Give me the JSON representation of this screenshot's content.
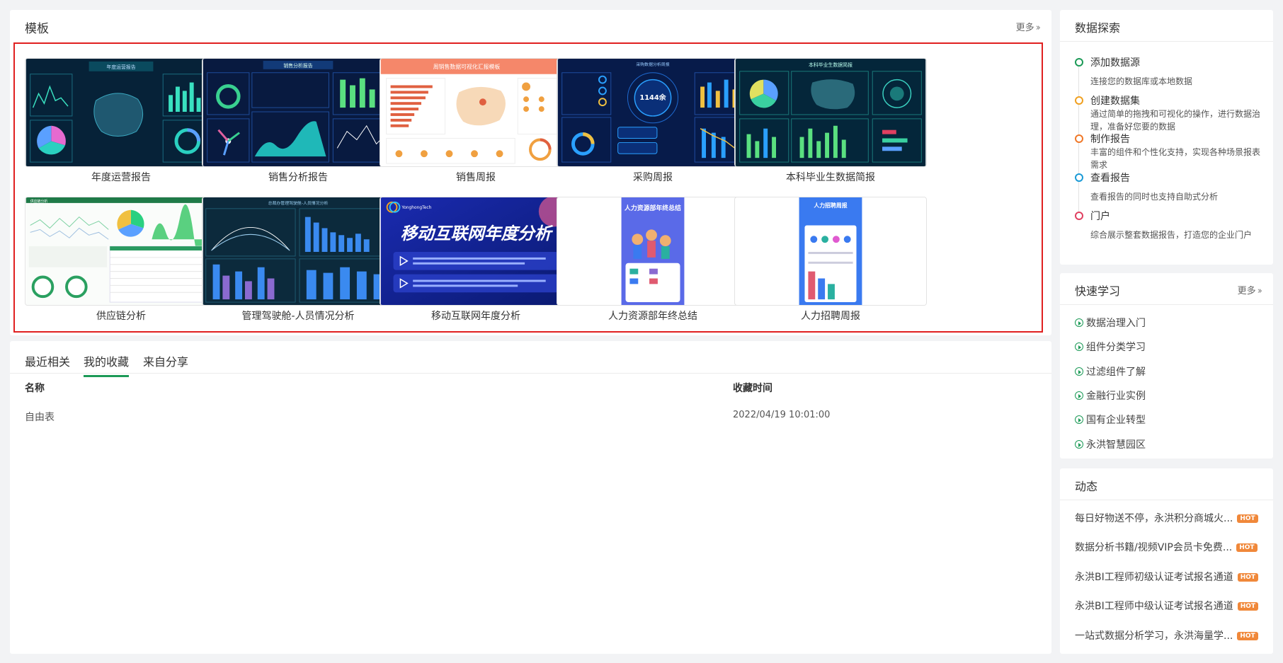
{
  "templates": {
    "title": "模板",
    "more": "更多",
    "cards": [
      {
        "label": "年度运营报告",
        "image_title": "年度运营报告"
      },
      {
        "label": "销售分析报告",
        "image_title": "销售分析报告"
      },
      {
        "label": "销售周报",
        "image_title": "周销售数据可视化汇报模板"
      },
      {
        "label": "采购周报",
        "image_title": "采购数据分析周报",
        "image_value": "1144余"
      },
      {
        "label": "本科毕业生数据简报",
        "image_title": "本科毕业生数据简报"
      },
      {
        "label": "供应链分析",
        "image_title": "供应链分析"
      },
      {
        "label": "管理驾驶舱-人员情况分析",
        "image_title": "总裁办管理驾驶舱-人员情况分析"
      },
      {
        "label": "移动互联网年度分析",
        "image_title": "移动互联网年度分析",
        "image_brand": "YonghongTech"
      },
      {
        "label": "人力资源部年终总结",
        "image_title": "人力资源部年终总结"
      },
      {
        "label": "人力招聘周报",
        "image_title": "人力招聘周报"
      }
    ]
  },
  "favorites": {
    "tabs": [
      "最近相关",
      "我的收藏",
      "来自分享"
    ],
    "active_tab": 1,
    "columns": {
      "name": "名称",
      "time": "收藏时间"
    },
    "rows": [
      {
        "name": "自由表",
        "time": "2022/04/19 10:01:00"
      }
    ]
  },
  "explore": {
    "title": "数据探索",
    "steps": [
      {
        "title": "添加数据源",
        "desc": "连接您的数据库或本地数据",
        "color": "#1c9a57"
      },
      {
        "title": "创建数据集",
        "desc": "通过简单的拖拽和可视化的操作，进行数据治理，准备好您要的数据",
        "color": "#f0a020"
      },
      {
        "title": "制作报告",
        "desc": "丰富的组件和个性化支持，实现各种场景报表需求",
        "color": "#f07828"
      },
      {
        "title": "查看报告",
        "desc": "查看报告的同时也支持自助式分析",
        "color": "#1a9ad6"
      },
      {
        "title": "门户",
        "desc": "综合展示整套数据报告，打造您的企业门户",
        "color": "#e04060"
      }
    ]
  },
  "learn": {
    "title": "快速学习",
    "more": "更多",
    "items": [
      "数据治理入门",
      "组件分类学习",
      "过滤组件了解",
      "金融行业实例",
      "国有企业转型",
      "永洪智慧园区"
    ]
  },
  "news": {
    "title": "动态",
    "hot_label": "HOT",
    "items": [
      "每日好物送不停，永洪积分商城火...",
      "数据分析书籍/视频VIP会员卡免费...",
      "永洪BI工程师初级认证考试报名通道",
      "永洪BI工程师中级认证考试报名通道",
      "一站式数据分析学习，永洪海量学..."
    ]
  }
}
